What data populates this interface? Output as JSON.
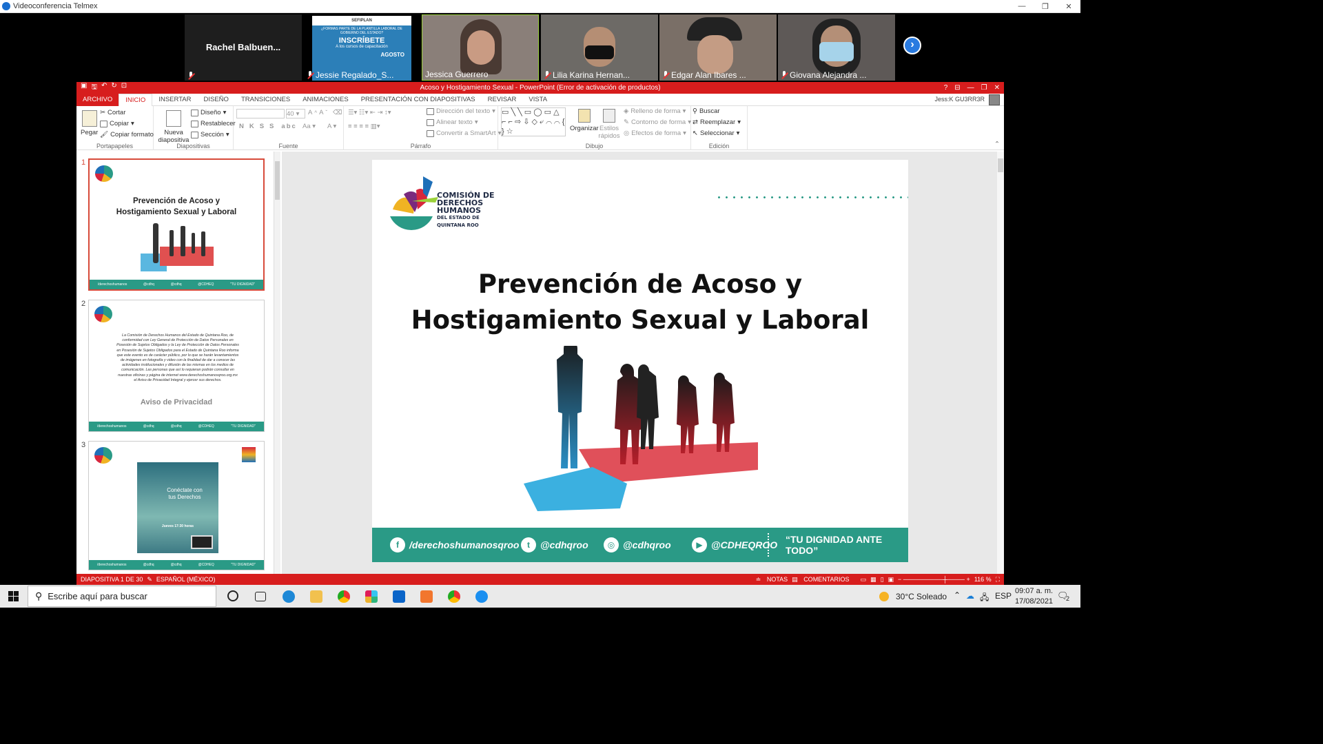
{
  "app": {
    "title": "Videoconferencia Telmex"
  },
  "window_controls": [
    "—",
    "❐",
    "✕"
  ],
  "participants": [
    {
      "name": "Rachel  Balbuen...",
      "bg": "#1e1e1e"
    },
    {
      "name": "Jessie Regalado_S...",
      "bg": "#2c7fb8"
    },
    {
      "name": "Jessica Guerrero",
      "bg": "#8a7f79"
    },
    {
      "name": "Lilia Karina Hernan...",
      "bg": "#6d6a66"
    },
    {
      "name": "Edgar Alan Ibares ...",
      "bg": "#7a6f67"
    },
    {
      "name": "Giovana Alejandra ...",
      "bg": "#5e5957"
    }
  ],
  "poster": {
    "brand": "SEFIPLAN",
    "line1": "¿FORMAS PARTE DE LA PLANTILLA LABORAL DE GOBIERNO DEL ESTADO?",
    "line2": "INSCRÍBETE",
    "line3": "A los cursos de capacitación",
    "line4": "AGOSTO"
  },
  "powerpoint": {
    "title": "Acoso y Hostigamiento Sexual  -  PowerPoint (Error de activación de productos)",
    "user": "Jess:K GU3RR3R",
    "tabs": [
      "ARCHIVO",
      "INICIO",
      "INSERTAR",
      "DISEÑO",
      "TRANSICIONES",
      "ANIMACIONES",
      "PRESENTACIÓN CON DIAPOSITIVAS",
      "REVISAR",
      "VISTA"
    ],
    "ribbon": {
      "portapapeles": {
        "label": "Portapapeles",
        "pegar": "Pegar",
        "cortar": "Cortar",
        "copiar": "Copiar",
        "copiar_formato": "Copiar formato"
      },
      "diapositivas": {
        "label": "Diapositivas",
        "nueva": "Nueva diapositiva",
        "diseno": "Diseño",
        "restablecer": "Restablecer",
        "seccion": "Sección"
      },
      "fuente": {
        "label": "Fuente",
        "size": "40"
      },
      "parrafo": {
        "label": "Párrafo",
        "direccion": "Dirección del texto",
        "alinear": "Alinear texto",
        "smartart": "Convertir a SmartArt"
      },
      "dibujo": {
        "label": "Dibujo",
        "organizar": "Organizar",
        "estilos": "Estilos rápidos",
        "relleno": "Relleno de forma",
        "contorno": "Contorno de forma",
        "efectos": "Efectos de forma"
      },
      "edicion": {
        "label": "Edición",
        "buscar": "Buscar",
        "reemplazar": "Reemplazar",
        "seleccionar": "Seleccionar"
      }
    },
    "thumbnails": [
      {
        "num": "1",
        "title": "Prevención  de Acoso y Hostigamiento Sexual y Laboral"
      },
      {
        "num": "2",
        "text": "La Comisión de Derechos Humanos del Estado de Quintana Roo, de conformidad con Ley General de Protección de Datos Personales en Posesión de Sujetos Obligados y la Ley de Protección de Datos Personales en Posesión de Sujetos Obligados para el Estado de Quintana Roo informa que este evento es de carácter público, por lo que se harán levantamientos de imágenes en fotografía y video con la finalidad de dar a conocer las actividades institucionales y difusión de las mismas en los medios de comunicación. Las personas que así lo requieran podrán consultar en nuestras oficinas y página de internet www.derechoshumanosqroo.org.mx el Aviso de Privacidad Integral y ejercer sus derechos.",
        "title": "Aviso de Privacidad"
      },
      {
        "num": "3",
        "title": "Conéctate con tus Derechos",
        "sub": "Jueves 17:30 horas"
      }
    ],
    "slide": {
      "org": [
        "COMISIÓN DE",
        "DERECHOS",
        "HUMANOS",
        "DEL ESTADO DE",
        "QUINTANA ROO"
      ],
      "title_line1": "Prevención  de Acoso y",
      "title_line2": "Hostigamiento Sexual y Laboral",
      "footer": [
        "/derechoshumanosqroo",
        "@cdhqroo",
        "@cdhqroo",
        "@CDHEQROO",
        "“TU DIGNIDAD ANTE TODO”"
      ],
      "accent": "#2a9a86"
    },
    "status": {
      "slide": "DIAPOSITIVA 1 DE 30",
      "lang": "ESPAÑOL (MÉXICO)",
      "notes": "NOTAS",
      "comments": "COMENTARIOS",
      "zoom": "116 %"
    }
  },
  "taskbar": {
    "search": "Escribe aquí para buscar",
    "temp": "30°C",
    "weather": "Soleado",
    "lang": "ESP",
    "time": "09:07 a. m.",
    "date": "17/08/2021",
    "notif": "2"
  }
}
